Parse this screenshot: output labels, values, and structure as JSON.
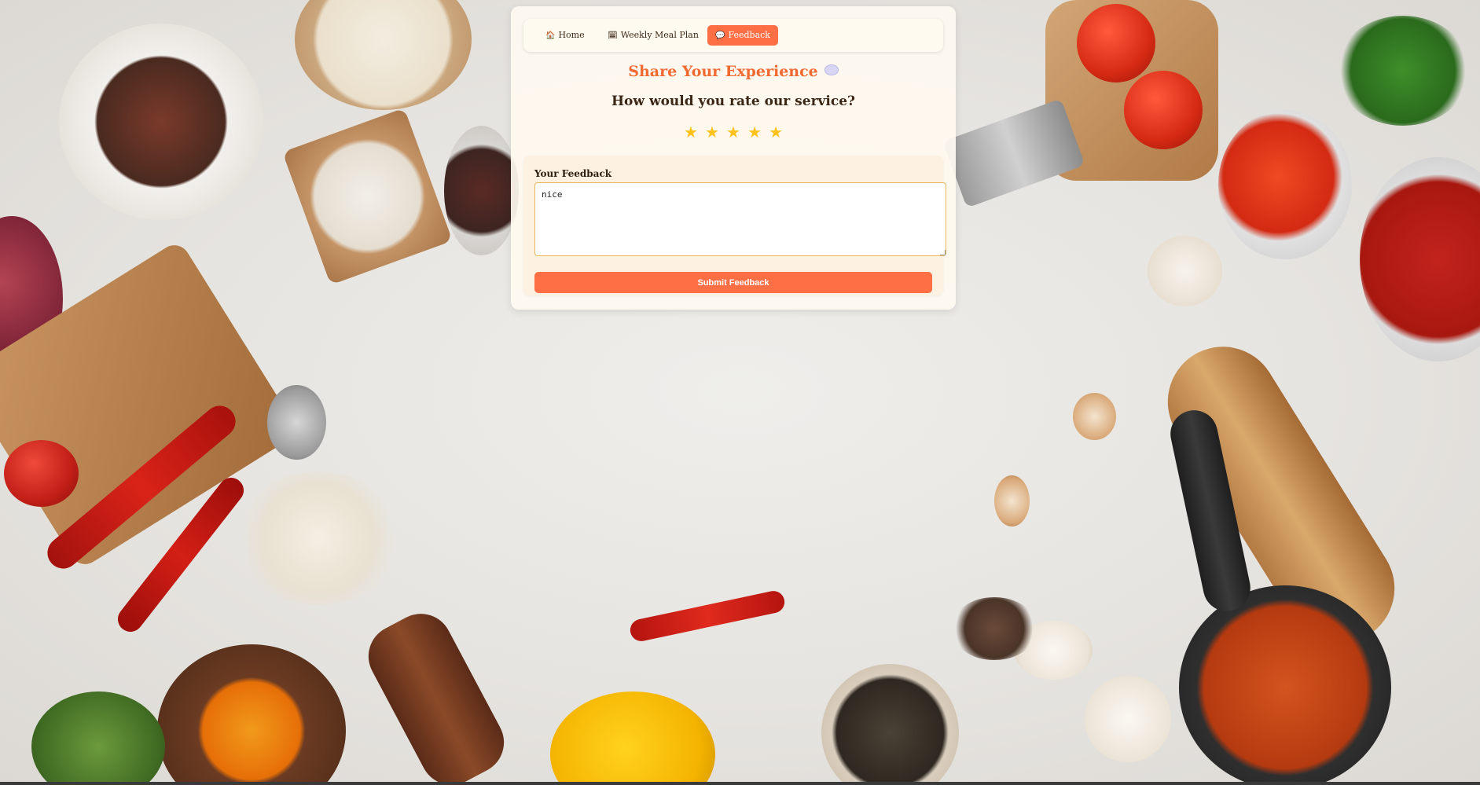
{
  "nav": {
    "items": [
      {
        "label": "Home",
        "icon": "house-icon",
        "active": false
      },
      {
        "label": "Weekly Meal Plan",
        "icon": "calendar-icon",
        "active": false
      },
      {
        "label": "Feedback",
        "icon": "speech-bubble-icon",
        "active": true
      }
    ]
  },
  "page": {
    "title": "Share Your Experience",
    "title_icon": "speech-bubble-icon",
    "question": "How would you rate our service?"
  },
  "rating": {
    "stars": [
      "★",
      "★",
      "★",
      "★",
      "★"
    ],
    "max": 5,
    "color": "#ffc21a"
  },
  "feedback": {
    "label": "Your Feedback",
    "value": "nice",
    "submit_label": "Submit Feedback"
  },
  "colors": {
    "accent": "#ff6f45",
    "title": "#f06a32",
    "text": "#3b2616"
  }
}
